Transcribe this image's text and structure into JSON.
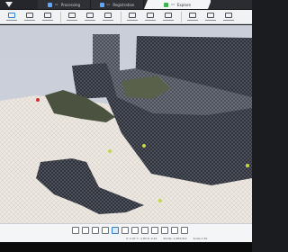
{
  "app": {
    "logo_icon": "app-logo-icon"
  },
  "stages": [
    {
      "num": "01",
      "label": "Processing",
      "icon": "processing-icon",
      "active": false
    },
    {
      "num": "02",
      "label": "Registration",
      "icon": "registration-icon",
      "active": false
    },
    {
      "num": "03",
      "label": "Explore",
      "icon": "explore-icon",
      "active": true
    }
  ],
  "toolbar": {
    "tools": [
      "measure-tool-icon",
      "select-tool-icon",
      "clip-tool-icon",
      "transform-tool-icon",
      "view-tool-icon",
      "section-tool-icon",
      "color-tool-icon",
      "layers-tool-icon",
      "export-tool-icon",
      "settings-tool-icon",
      "snapshot-tool-icon",
      "report-tool-icon"
    ]
  },
  "viewport": {
    "content": "point-cloud-3d-view"
  },
  "bottom": {
    "buttons": [
      "home-view-icon",
      "top-view-icon",
      "front-view-icon",
      "side-view-icon",
      "perspective-icon",
      "orbit-icon",
      "pan-icon",
      "zoom-icon",
      "fit-icon",
      "grid-icon",
      "measure-icon",
      "layers-icon"
    ],
    "status": [
      "X: 2.47  Y: -1.83  Z: 0.42",
      "Points: 1,284,312",
      "Scale 1:50"
    ]
  },
  "colors": {
    "accent": "#2f7fd1",
    "active_stage": "#f4f5f7",
    "mesh_dark": "#2d3039",
    "floor": "#e8e3dc"
  }
}
